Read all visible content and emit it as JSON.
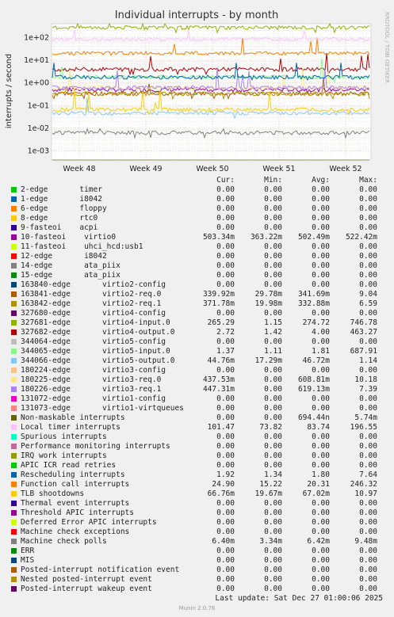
{
  "chart_data": {
    "type": "line",
    "title": "Individual interrupts - by month",
    "ylabel": "interrupts / second",
    "y_scale": "log",
    "ylim": [
      0.0004,
      400
    ],
    "y_ticks": [
      "1e+02",
      "1e+01",
      "1e+00",
      "1e-01",
      "1e-02",
      "1e-03"
    ],
    "x_ticks": [
      "Week 48",
      "Week 49",
      "Week 50",
      "Week 51",
      "Week 52"
    ],
    "side_label": "RRDTOOL / TOBI OETIKER",
    "grid": true,
    "series": [
      {
        "name": "2-edge       timer",
        "color": "#00cc00",
        "cur": "0.00",
        "min": "0.00",
        "avg": "0.00",
        "max": "0.00"
      },
      {
        "name": "1-edge       i8042",
        "color": "#0066b3",
        "cur": "0.00",
        "min": "0.00",
        "avg": "0.00",
        "max": "0.00"
      },
      {
        "name": "6-edge       floppy",
        "color": "#ff8000",
        "cur": "0.00",
        "min": "0.00",
        "avg": "0.00",
        "max": "0.00"
      },
      {
        "name": "8-edge       rtc0",
        "color": "#ffcc00",
        "cur": "0.00",
        "min": "0.00",
        "avg": "0.00",
        "max": "0.00"
      },
      {
        "name": "9-fasteoi    acpi",
        "color": "#330099",
        "cur": "0.00",
        "min": "0.00",
        "avg": "0.00",
        "max": "0.00"
      },
      {
        "name": "10-fasteoi    virtio0",
        "color": "#990099",
        "cur": "503.34m",
        "min": "363.22m",
        "avg": "502.49m",
        "max": "522.42m"
      },
      {
        "name": "11-fasteoi    uhci_hcd:usb1",
        "color": "#ccff00",
        "cur": "0.00",
        "min": "0.00",
        "avg": "0.00",
        "max": "0.00"
      },
      {
        "name": "12-edge       i8042",
        "color": "#ff0000",
        "cur": "0.00",
        "min": "0.00",
        "avg": "0.00",
        "max": "0.00"
      },
      {
        "name": "14-edge       ata_piix",
        "color": "#808080",
        "cur": "0.00",
        "min": "0.00",
        "avg": "0.00",
        "max": "0.00"
      },
      {
        "name": "15-edge       ata_piix",
        "color": "#008f00",
        "cur": "0.00",
        "min": "0.00",
        "avg": "0.00",
        "max": "0.00"
      },
      {
        "name": "163840-edge       virtio2-config",
        "color": "#00487d",
        "cur": "0.00",
        "min": "0.00",
        "avg": "0.00",
        "max": "0.00"
      },
      {
        "name": "163841-edge       virtio2-req.0",
        "color": "#b35a00",
        "cur": "339.92m",
        "min": "29.78m",
        "avg": "341.69m",
        "max": "9.04"
      },
      {
        "name": "163842-edge       virtio2-req.1",
        "color": "#b38f00",
        "cur": "371.78m",
        "min": "19.98m",
        "avg": "332.88m",
        "max": "6.59"
      },
      {
        "name": "327680-edge       virtio4-config",
        "color": "#6b006b",
        "cur": "0.00",
        "min": "0.00",
        "avg": "0.00",
        "max": "0.00"
      },
      {
        "name": "327681-edge       virtio4-input.0",
        "color": "#8fb300",
        "cur": "265.29",
        "min": "1.15",
        "avg": "274.72",
        "max": "746.78"
      },
      {
        "name": "327682-edge       virtio4-output.0",
        "color": "#b30000",
        "cur": "2.72",
        "min": "1.42",
        "avg": "4.00",
        "max": "463.27"
      },
      {
        "name": "344064-edge       virtio5-config",
        "color": "#bebebe",
        "cur": "0.00",
        "min": "0.00",
        "avg": "0.00",
        "max": "0.00"
      },
      {
        "name": "344065-edge       virtio5-input.0",
        "color": "#80ff80",
        "cur": "1.37",
        "min": "1.11",
        "avg": "1.81",
        "max": "687.91"
      },
      {
        "name": "344066-edge       virtio5-output.0",
        "color": "#80c9ff",
        "cur": "44.76m",
        "min": "17.29m",
        "avg": "46.72m",
        "max": "1.14"
      },
      {
        "name": "180224-edge       virtio3-config",
        "color": "#ffc080",
        "cur": "0.00",
        "min": "0.00",
        "avg": "0.00",
        "max": "0.00"
      },
      {
        "name": "180225-edge       virtio3-req.0",
        "color": "#ffe680",
        "cur": "437.53m",
        "min": "0.00",
        "avg": "608.81m",
        "max": "10.18"
      },
      {
        "name": "180226-edge       virtio3-req.1",
        "color": "#aa80ff",
        "cur": "447.31m",
        "min": "0.00",
        "avg": "619.13m",
        "max": "7.39"
      },
      {
        "name": "131072-edge       virtio1-config",
        "color": "#ee00cc",
        "cur": "0.00",
        "min": "0.00",
        "avg": "0.00",
        "max": "0.00"
      },
      {
        "name": "131073-edge       virtio1-virtqueues",
        "color": "#ff8080",
        "cur": "0.00",
        "min": "0.00",
        "avg": "0.00",
        "max": "0.00"
      },
      {
        "name": "Non-maskable interrupts",
        "color": "#666600",
        "cur": "0.00",
        "min": "0.00",
        "avg": "694.44n",
        "max": "5.74m"
      },
      {
        "name": "Local timer interrupts",
        "color": "#ffbfff",
        "cur": "101.47",
        "min": "73.82",
        "avg": "83.74",
        "max": "196.55"
      },
      {
        "name": "Spurious interrupts",
        "color": "#00ffcc",
        "cur": "0.00",
        "min": "0.00",
        "avg": "0.00",
        "max": "0.00"
      },
      {
        "name": "Performance monitoring interrupts",
        "color": "#cc6699",
        "cur": "0.00",
        "min": "0.00",
        "avg": "0.00",
        "max": "0.00"
      },
      {
        "name": "IRQ work interrupts",
        "color": "#999900",
        "cur": "0.00",
        "min": "0.00",
        "avg": "0.00",
        "max": "0.00"
      },
      {
        "name": "APIC ICR read retries",
        "color": "#00cc00",
        "cur": "0.00",
        "min": "0.00",
        "avg": "0.00",
        "max": "0.00"
      },
      {
        "name": "Rescheduling interrupts",
        "color": "#0066b3",
        "cur": "1.92",
        "min": "1.34",
        "avg": "1.80",
        "max": "7.64"
      },
      {
        "name": "Function call interrupts",
        "color": "#ff8000",
        "cur": "24.90",
        "min": "15.22",
        "avg": "20.31",
        "max": "246.32"
      },
      {
        "name": "TLB shootdowns",
        "color": "#ffcc00",
        "cur": "66.76m",
        "min": "19.67m",
        "avg": "67.02m",
        "max": "10.97"
      },
      {
        "name": "Thermal event interrupts",
        "color": "#330099",
        "cur": "0.00",
        "min": "0.00",
        "avg": "0.00",
        "max": "0.00"
      },
      {
        "name": "Threshold APIC interrupts",
        "color": "#990099",
        "cur": "0.00",
        "min": "0.00",
        "avg": "0.00",
        "max": "0.00"
      },
      {
        "name": "Deferred Error APIC interrupts",
        "color": "#ccff00",
        "cur": "0.00",
        "min": "0.00",
        "avg": "0.00",
        "max": "0.00"
      },
      {
        "name": "Machine check exceptions",
        "color": "#ff0000",
        "cur": "0.00",
        "min": "0.00",
        "avg": "0.00",
        "max": "0.00"
      },
      {
        "name": "Machine check polls",
        "color": "#808080",
        "cur": "6.40m",
        "min": "3.34m",
        "avg": "6.42m",
        "max": "9.48m"
      },
      {
        "name": "ERR",
        "color": "#008f00",
        "cur": "0.00",
        "min": "0.00",
        "avg": "0.00",
        "max": "0.00"
      },
      {
        "name": "MIS",
        "color": "#00487d",
        "cur": "0.00",
        "min": "0.00",
        "avg": "0.00",
        "max": "0.00"
      },
      {
        "name": "Posted-interrupt notification event",
        "color": "#b35a00",
        "cur": "0.00",
        "min": "0.00",
        "avg": "0.00",
        "max": "0.00"
      },
      {
        "name": "Nested posted-interrupt event",
        "color": "#b38f00",
        "cur": "0.00",
        "min": "0.00",
        "avg": "0.00",
        "max": "0.00"
      },
      {
        "name": "Posted-interrupt wakeup event",
        "color": "#6b006b",
        "cur": "0.00",
        "min": "0.00",
        "avg": "0.00",
        "max": "0.00"
      }
    ],
    "column_headers": {
      "cur": "Cur:",
      "min": "Min:",
      "avg": "Avg:",
      "max": "Max:"
    }
  },
  "footer": {
    "last_update": "Last update: Sat Dec 27 01:00:06 2025",
    "version": "Munin 2.0.76"
  }
}
